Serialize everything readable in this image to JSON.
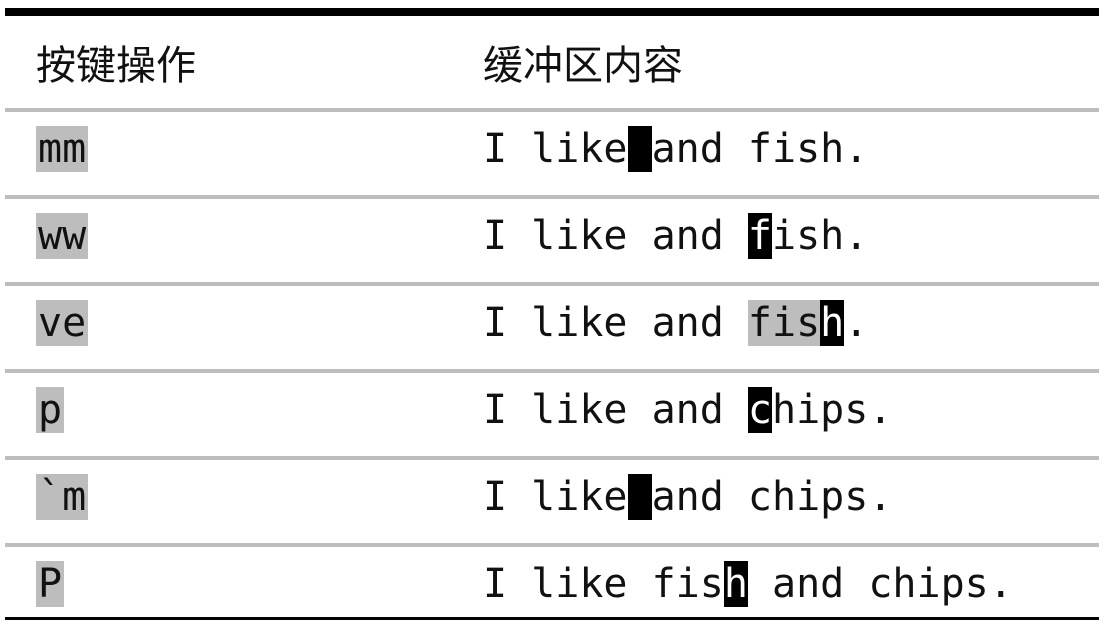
{
  "table": {
    "headers": {
      "key": "按键操作",
      "buffer": "缓冲区内容"
    },
    "rows": [
      {
        "key": "mm",
        "before": "I like",
        "visual": "",
        "cursor": " ",
        "after": "and fish."
      },
      {
        "key": "ww",
        "before": "I like and ",
        "visual": "",
        "cursor": "f",
        "after": "ish."
      },
      {
        "key": "ve",
        "before": "I like and ",
        "visual": "fis",
        "cursor": "h",
        "after": "."
      },
      {
        "key": "p",
        "before": "I like and ",
        "visual": "",
        "cursor": "c",
        "after": "hips."
      },
      {
        "key": "`m",
        "before": "I like",
        "visual": "",
        "cursor": " ",
        "after": "and chips."
      },
      {
        "key": "P",
        "before": "I like fis",
        "visual": "",
        "cursor": "h",
        "after": " and chips."
      }
    ]
  }
}
